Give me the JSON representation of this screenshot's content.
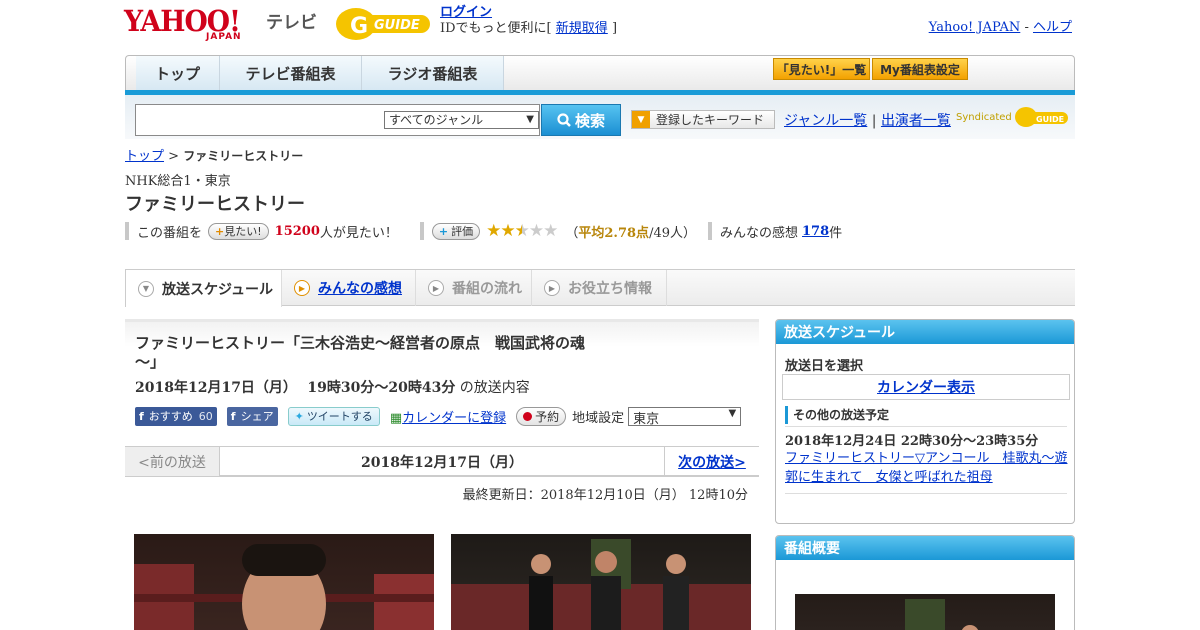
{
  "header": {
    "logo_text": "YAHOO!",
    "logo_sub": "JAPAN",
    "service_label": "テレビ",
    "gguide_logo": "G-GUIDE",
    "login_link": "ログイン",
    "login_prefix": "IDでもっと便利に[",
    "signup_link": "新規取得",
    "login_suffix": "]",
    "yahoo_japan_link": "Yahoo! JAPAN",
    "help_sep": "-",
    "help_link": "ヘルプ"
  },
  "nav": {
    "tabs": [
      "トップ",
      "テレビ番組表",
      "ラジオ番組表"
    ],
    "want_list_btn": "「見たい!」一覧",
    "my_schedule_btn": "My番組表設定"
  },
  "search": {
    "input_value": "",
    "genre_selected": "すべてのジャンル",
    "search_button": "検索",
    "keyword_button": "登録したキーワード",
    "genre_list_link": "ジャンル一覧",
    "divider": "|",
    "cast_list_link": "出演者一覧",
    "syndicated_label": "Syndicated"
  },
  "breadcrumb": {
    "home": "トップ",
    "sep": ">",
    "current": "ファミリーヒストリー"
  },
  "program": {
    "channel": "NHK総合1・東京",
    "title": "ファミリーヒストリー",
    "want_prefix": "この番組を",
    "want_button": "見たい!",
    "want_count": "15200",
    "want_suffix": "人が見たい！",
    "rate_button": "評価",
    "rating_value": 2.78,
    "rating_open": "（",
    "rating_avg": "平均2.78点",
    "rating_count": "/49人）",
    "comments_label": "みんなの感想",
    "comments_count": "178",
    "comments_suffix": "件"
  },
  "tabs": [
    {
      "label": "放送スケジュール",
      "active": true
    },
    {
      "label": "みんなの感想",
      "active": false,
      "link": true
    },
    {
      "label": "番組の流れ",
      "active": false
    },
    {
      "label": "お役立ち情報",
      "active": false
    }
  ],
  "episode": {
    "title": "ファミリーヒストリー「三木谷浩史～経営者の原点　戦国武将の魂～」",
    "air_date": "2018年12月17日（月）",
    "air_time": "19時30分～20時43分",
    "air_suffix": "の放送内容",
    "fb_recommend": "おすすめ",
    "fb_recommend_count": "60",
    "fb_share": "シェア",
    "tweet": "ツイートする",
    "calendar_register": "カレンダーに登録",
    "reserve": "予約",
    "region_label": "地域設定",
    "region_selected": "東京"
  },
  "pager": {
    "prev": "<前の放送",
    "current": "2018年12月17日（月）",
    "next": "次の放送>"
  },
  "last_updated": "最終更新日：2018年12月10日（月）  12時10分",
  "sidebar": {
    "schedule_header": "放送スケジュール",
    "select_date_label": "放送日を選択",
    "calendar_button": "カレンダー表示",
    "other_schedule_header": "その他の放送予定",
    "other_date": "2018年12月24日  22時30分～23時35分",
    "other_link": "ファミリーヒストリー▽アンコール　桂歌丸～遊郭に生まれて　女傑と呼ばれた祖母",
    "summary_header": "番組概要"
  },
  "colors": {
    "brand_red": "#d0021b",
    "accent_blue": "#1b98d6",
    "link_blue": "#0033cc",
    "star_gold": "#e0a800"
  }
}
